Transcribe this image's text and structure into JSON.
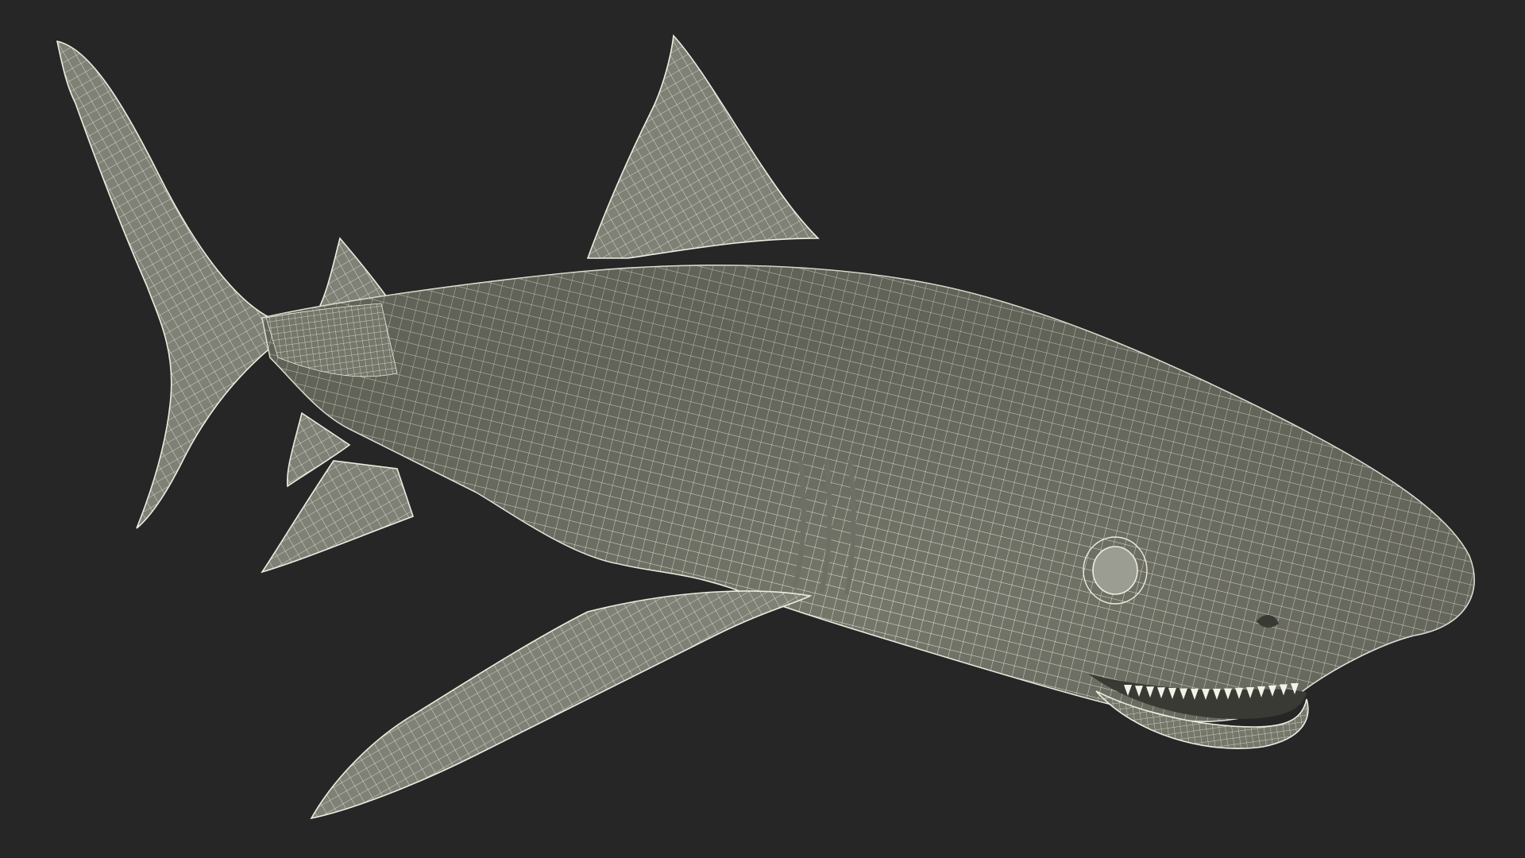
{
  "scene": {
    "subject": "shark-wireframe-model",
    "colors": {
      "background": "#262626",
      "surface": "#76776b",
      "surface_dark": "#6a6b60",
      "surface_light": "#808176",
      "wire": "#ecece0",
      "eye": "#9c9d92",
      "mouth": "#3a3a34",
      "teeth": "#f2f2e8",
      "gill": "#6f7065"
    }
  }
}
